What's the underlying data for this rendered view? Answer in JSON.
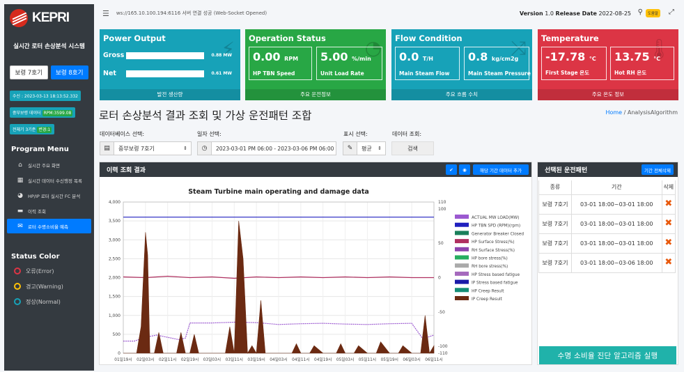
{
  "app": {
    "logo": "KEPRI",
    "system_title": "실시간 로터 손상분석 시스템"
  },
  "units": {
    "unit7": "보령 7호기",
    "unit8": "보령 8호기"
  },
  "sidebar_info": {
    "received": "수신 : 2023-03-13 18:13:52.332",
    "data_label": "중부보령 데이터",
    "rpm": "RPM:3599.08",
    "total_label": "전체기 3기준",
    "sync": "변경:1"
  },
  "menu": {
    "title": "Program Menu",
    "items": [
      "실시간 주요 화면",
      "실시간 데이터 수신행정 목록",
      "HP/IP 로터 실시간 FC 분석",
      "이력 조회",
      "로터 수명소비율 예측"
    ]
  },
  "status": {
    "title": "Status Color",
    "error": "오류(Error)",
    "warning": "경고(Warning)",
    "normal": "정상(Normal)",
    "colors": {
      "error": "#dc3545",
      "warning": "#ffc107",
      "normal": "#17a2b8"
    }
  },
  "topbar": {
    "ws": "ws://165.10.100.194:6116 서버 연결 성공 (Web-Socket Opened)",
    "version_label": "Version",
    "version": "1.0",
    "release_label": "Release Date",
    "release": "2022-08-25",
    "badge": "도움말"
  },
  "cards": {
    "power": {
      "title": "Power Output",
      "gross_label": "Gross",
      "gross": "0.88",
      "unit": "MW",
      "net_label": "Net",
      "net": "0.61",
      "foot": "발전 생산량"
    },
    "operation": {
      "title": "Operation Status",
      "speed": "0.00",
      "speed_unit": "RPM",
      "speed_label": "HP TBN Speed",
      "load": "5.00",
      "load_unit": "%/min",
      "load_label": "Unit Load Rate",
      "foot": "주요 운전정보"
    },
    "flow": {
      "title": "Flow Condition",
      "flow": "0.0",
      "flow_unit": "T/H",
      "flow_label": "Main Steam Flow",
      "pressure": "0.8",
      "pressure_unit": "kg/cm2g",
      "pressure_label": "Main Steam Pressure",
      "foot": "주요 흐름 수치"
    },
    "temperature": {
      "title": "Temperature",
      "t1": "-17.78",
      "t1_unit": "°C",
      "t1_label": "First Stage 온도",
      "t2": "13.75",
      "t2_unit": "°C",
      "t2_label": "Hot RH 온도",
      "foot": "주요 온도 정보"
    }
  },
  "page": {
    "title": "로터 손상분석 결과 조회 및 가상 운전패턴 조합",
    "crumb_home": "Home",
    "crumb_sep": "/",
    "crumb_current": "AnalysisAlgorithm"
  },
  "filters": {
    "db_label": "데이터베이스 선택:",
    "db_value": "중부보령 7호기",
    "date_label": "일자 선택:",
    "date_value": "2023-03-01 PM 06:00 - 2023-03-06 PM 06:00",
    "display_label": "표시 선택:",
    "display_value": "평균",
    "query_label": "데이터 조회:",
    "query_button": "검색"
  },
  "history_panel": {
    "title": "이력 조회 결과",
    "add_button": "해당 기간 데이터 추가"
  },
  "pattern_panel": {
    "title": "선택된 운전패턴",
    "delete_all": "기간 전체삭제",
    "headers": [
      "종류",
      "기간",
      "삭제"
    ],
    "rows": [
      [
        "보령 7호기",
        "03-01 18:00~03-01 18:00"
      ],
      [
        "보령 7호기",
        "03-01 18:00~03-01 18:00"
      ],
      [
        "보령 7호기",
        "03-01 18:00~03-01 18:00"
      ],
      [
        "보령 7호기",
        "03-01 18:00~03-06 18:00"
      ]
    ],
    "run_button": "수명 소비율 진단 알고리즘 실행"
  },
  "chart_data": {
    "type": "line",
    "title": "Steam Turbine main operating and damage data",
    "left_ylim": [
      0,
      4000
    ],
    "right_ylim": [
      -110,
      110
    ],
    "left_ticks": [
      "0",
      "500",
      "1,000",
      "1,500",
      "2,000",
      "2,500",
      "3,000",
      "3,500",
      "4,000"
    ],
    "right_ticks": [
      "-110",
      "-100",
      "-50",
      "0",
      "50",
      "100",
      "110"
    ],
    "x_ticks": [
      "01일19시",
      "02일03시",
      "02일11시",
      "02일19시",
      "03일03시",
      "03일11시",
      "03일19시",
      "04일03시",
      "04일11시",
      "04일19시",
      "05일03시",
      "05일11시",
      "05일19시",
      "06일03시",
      "06일11시"
    ],
    "legend": [
      {
        "name": "ACTUAL MW LOAD(MW)",
        "color": "#9b59d0"
      },
      {
        "name": "HP TBN SPD (RPM)(rpm)",
        "color": "#1f1fbf"
      },
      {
        "name": "Generator Breaker Closed",
        "color": "#1a7f5a"
      },
      {
        "name": "HP Surface Stress(%)",
        "color": "#b03060"
      },
      {
        "name": "RH Surface Stress(%)",
        "color": "#8e44ad"
      },
      {
        "name": "HP bore stress(%)",
        "color": "#27ae60"
      },
      {
        "name": "RH bore stress(%)",
        "color": "#aaaaaa"
      },
      {
        "name": "HP Stress based fatigue",
        "color": "#a569bd"
      },
      {
        "name": "IP Stress based fatigue",
        "color": "#1a1aa8"
      },
      {
        "name": "HP Creep Result",
        "color": "#138d75"
      },
      {
        "name": "IP Creep Result",
        "color": "#6b2a12"
      }
    ],
    "series": [
      {
        "name": "HP TBN SPD (RPM)(rpm)",
        "axis": "left",
        "x": [
          0,
          14
        ],
        "values": [
          3600,
          3600
        ]
      },
      {
        "name": "HP Surface Stress(%)",
        "axis": "right",
        "x": [
          0,
          1,
          2,
          3,
          4,
          5,
          6,
          7,
          8,
          9,
          10,
          11,
          12,
          13,
          14
        ],
        "values": [
          1,
          0,
          2,
          0,
          1,
          -1,
          1,
          0,
          1,
          0,
          1,
          0,
          1,
          0,
          0
        ]
      },
      {
        "name": "ACTUAL MW LOAD(MW)",
        "axis": "left",
        "x": [
          0,
          0.5,
          1,
          1.5,
          2,
          2.5,
          2.8,
          3,
          4,
          5,
          6,
          7,
          8,
          9,
          10,
          11,
          12,
          13,
          13.5,
          14
        ],
        "values": [
          320,
          320,
          420,
          480,
          420,
          360,
          400,
          800,
          800,
          820,
          810,
          760,
          780,
          790,
          770,
          760,
          780,
          790,
          380,
          480
        ]
      },
      {
        "name": "IP Creep Result",
        "axis": "left",
        "x": [
          0,
          0.6,
          0.8,
          1,
          1.1,
          1.2,
          1.4,
          1.6,
          1.8,
          2,
          2.4,
          2.6,
          2.8,
          3,
          3.2,
          3.4,
          4,
          4.6,
          4.8,
          5,
          5.2,
          5.4,
          5.6,
          5.8,
          6,
          6.2,
          6.4,
          6.6,
          7,
          7.6,
          7.8,
          8,
          8.4,
          8.6,
          9,
          9.6,
          9.8,
          10,
          10.4,
          10.6,
          11,
          11.4,
          11.6,
          12,
          12.4,
          12.6,
          13,
          13.4,
          13.6,
          13.8,
          14
        ],
        "values": [
          0,
          0,
          700,
          3200,
          2600,
          0,
          0,
          550,
          0,
          0,
          0,
          550,
          0,
          0,
          500,
          0,
          0,
          0,
          700,
          0,
          3500,
          2500,
          0,
          200,
          0,
          1400,
          0,
          0,
          0,
          0,
          250,
          0,
          0,
          200,
          0,
          0,
          250,
          0,
          0,
          200,
          0,
          0,
          300,
          0,
          0,
          200,
          0,
          0,
          1000,
          0,
          200
        ]
      }
    ]
  }
}
